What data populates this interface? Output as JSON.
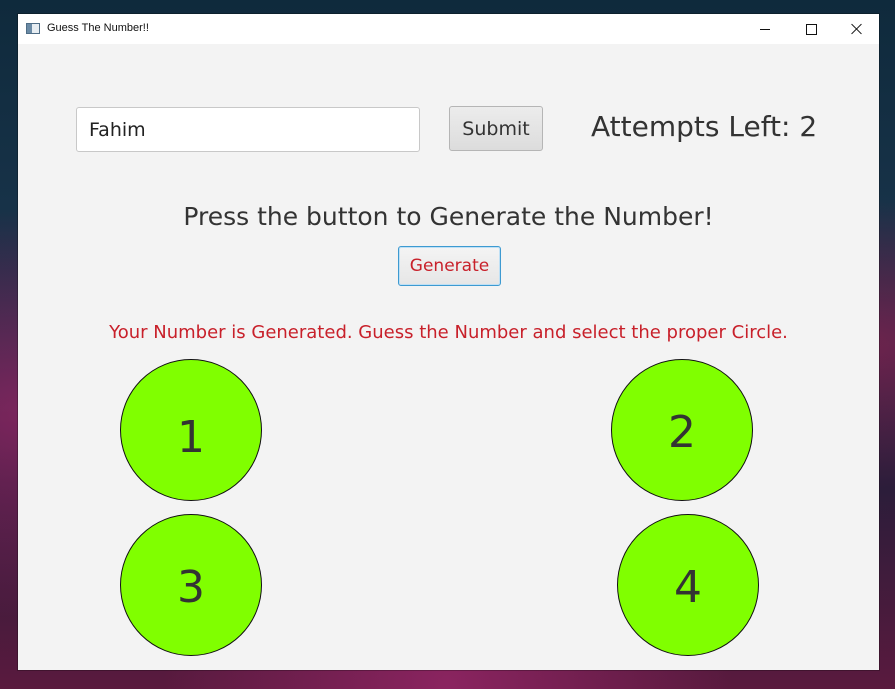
{
  "window": {
    "title": "Guess The Number!!",
    "controls": {
      "minimize_icon": "minimize-icon",
      "maximize_icon": "maximize-icon",
      "close_icon": "close-icon"
    }
  },
  "form": {
    "name_value": "Fahim",
    "submit_label": "Submit",
    "attempts_text": "Attempts Left: 2"
  },
  "prompt_text": "Press the button to Generate the Number!",
  "generate_label": "Generate",
  "status_text": "Your Number is Generated. Guess the Number and select the proper Circle.",
  "circles": [
    {
      "label": "1"
    },
    {
      "label": "2"
    },
    {
      "label": "3"
    },
    {
      "label": "4"
    }
  ],
  "colors": {
    "circle_fill": "#80ff00",
    "accent_red": "#c8202a",
    "focus_blue": "#3d9ad1",
    "window_bg": "#f3f3f3"
  }
}
